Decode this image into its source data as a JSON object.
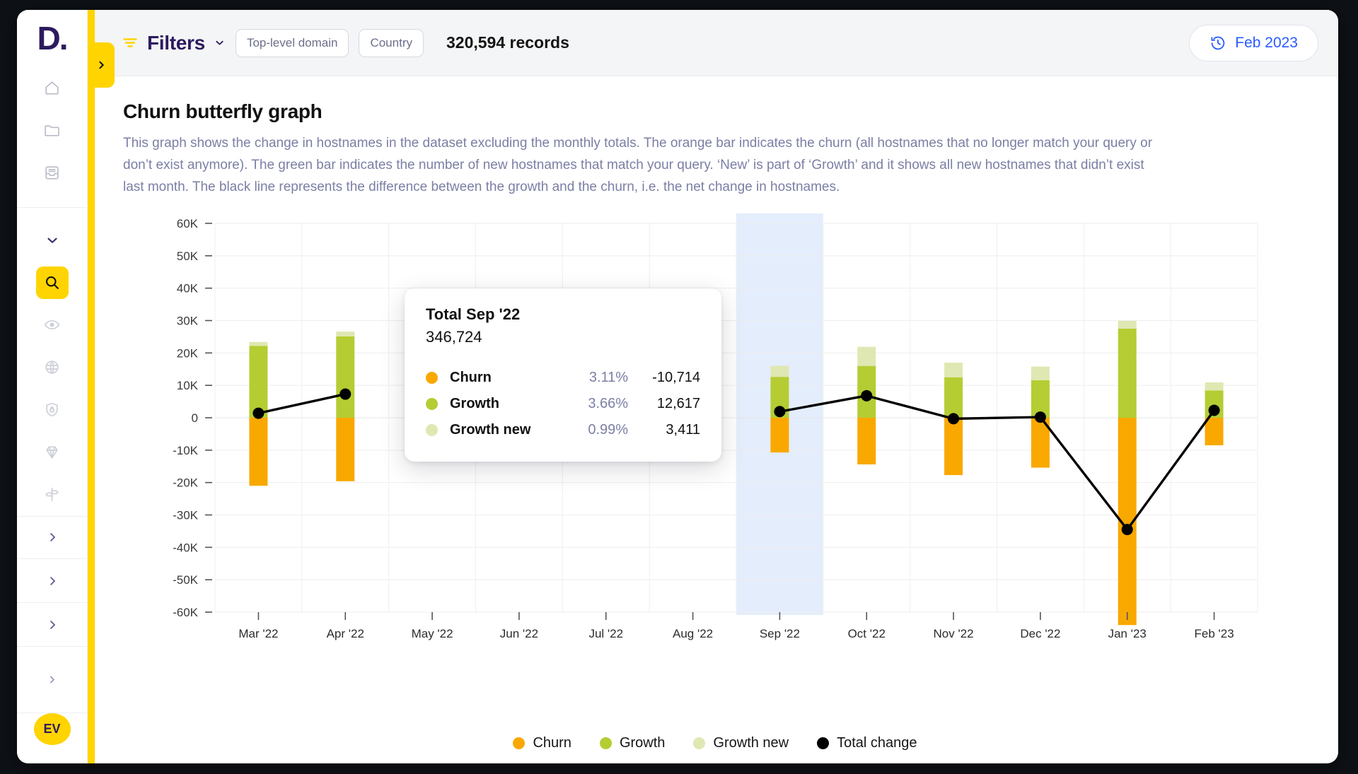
{
  "app": {
    "logo_text": "D.",
    "drawer_toggle_icon": "chevron-right-icon"
  },
  "sidebar": {
    "top_items": [
      {
        "icon": "home-icon",
        "name": "home"
      },
      {
        "icon": "folder-icon",
        "name": "folder"
      },
      {
        "icon": "inbox-icon",
        "name": "inbox"
      }
    ],
    "nav_items": [
      {
        "icon": "chevron-down-icon",
        "name": "collapse"
      },
      {
        "icon": "search-icon",
        "name": "search",
        "active": true
      },
      {
        "icon": "eye-icon",
        "name": "watch"
      },
      {
        "icon": "globe-icon",
        "name": "globe"
      },
      {
        "icon": "shield-lock-icon",
        "name": "security"
      },
      {
        "icon": "diamond-icon",
        "name": "brand"
      },
      {
        "icon": "signpost-icon",
        "name": "routing"
      }
    ],
    "expand_items": [
      {
        "icon": "chevron-right-icon",
        "name": "section-1"
      },
      {
        "icon": "chevron-right-icon",
        "name": "section-2"
      },
      {
        "icon": "chevron-right-icon",
        "name": "section-3"
      },
      {
        "icon": "chevron-right-icon",
        "name": "section-4"
      }
    ],
    "avatar_initials": "EV"
  },
  "topbar": {
    "filter_icon": "filter-icon",
    "filters_label": "Filters",
    "filters_caret_icon": "chevron-down-icon",
    "chips": [
      {
        "label": "Top-level domain"
      },
      {
        "label": "Country"
      }
    ],
    "records_label": "320,594 records",
    "datepicker": {
      "icon": "history-clock-icon",
      "label": "Feb 2023"
    }
  },
  "main": {
    "title": "Churn butterfly graph",
    "description": "This graph shows the change in hostnames in the dataset excluding the monthly totals. The orange bar indicates the churn (all hostnames that no longer match your query or don’t exist anymore). The green bar indicates the number of new hostnames that match your query. ‘New’ is part of ‘Growth’ and it shows all new hostnames that didn’t exist last month. The black line represents the difference between the growth and the churn, i.e. the net change in hostnames."
  },
  "tooltip": {
    "title": "Total Sep '22",
    "total": "346,724",
    "rows": [
      {
        "name": "Churn",
        "pct": "3.11%",
        "value": "-10,714",
        "color": "#f9a800"
      },
      {
        "name": "Growth",
        "pct": "3.66%",
        "value": "12,617",
        "color": "#b5cd33"
      },
      {
        "name": "Growth new",
        "pct": "0.99%",
        "value": "3,411",
        "color": "#dfe8b2"
      }
    ]
  },
  "colors": {
    "churn": "#f9a800",
    "growth": "#b5cd33",
    "growth_new": "#dfe8b2",
    "total_change": "#000000",
    "highlight_band": "#e4edfc",
    "accent_yellow": "#ffd400",
    "brand_purple": "#2d1b5e",
    "link_blue": "#2a5bff"
  },
  "chart_data": {
    "type": "bar",
    "title": "Churn butterfly graph",
    "xlabel": "",
    "ylabel": "",
    "ylim": [
      -60000,
      60000
    ],
    "ytick_labels": [
      "60K",
      "50K",
      "40K",
      "30K",
      "20K",
      "10K",
      "0",
      "-10K",
      "-20K",
      "-30K",
      "-40K",
      "-50K",
      "-60K"
    ],
    "ytick_values": [
      60000,
      50000,
      40000,
      30000,
      20000,
      10000,
      0,
      -10000,
      -20000,
      -30000,
      -40000,
      -50000,
      -60000
    ],
    "grid": true,
    "legend_position": "bottom",
    "legend": [
      "Churn",
      "Growth",
      "Growth new",
      "Total change"
    ],
    "highlighted_category": "Sep '22",
    "categories": [
      "Mar '22",
      "Apr '22",
      "May '22",
      "Jun '22",
      "Jul '22",
      "Aug '22",
      "Sep '22",
      "Oct '22",
      "Nov '22",
      "Dec '22",
      "Jan '23",
      "Feb '23"
    ],
    "series": [
      {
        "name": "Churn",
        "color": "#f9a800",
        "values": [
          -21000,
          -19600,
          null,
          null,
          null,
          null,
          -10714,
          -14400,
          -17700,
          -15400,
          -64000,
          -8500
        ]
      },
      {
        "name": "Growth",
        "color": "#b5cd33",
        "values": [
          22200,
          25100,
          null,
          null,
          null,
          null,
          12617,
          16000,
          12500,
          11600,
          27500,
          8400
        ]
      },
      {
        "name": "Growth new",
        "color": "#dfe8b2",
        "values": [
          1200,
          1500,
          null,
          null,
          null,
          null,
          3411,
          5900,
          4500,
          4200,
          2400,
          2500
        ]
      },
      {
        "name": "Total change",
        "color": "#000000",
        "type": "line",
        "values": [
          1400,
          7300,
          null,
          null,
          null,
          null,
          1903,
          6800,
          -300,
          200,
          -34500,
          2300
        ]
      }
    ]
  }
}
